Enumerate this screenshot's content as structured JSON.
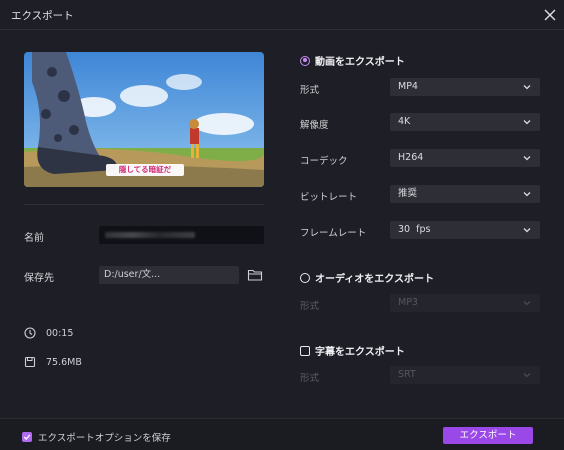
{
  "window": {
    "title": "エクスポート"
  },
  "left": {
    "name_label": "名前",
    "save_label": "保存先",
    "save_path": "D:/user/文...",
    "duration": "00:15",
    "size": "75.6MB",
    "subtitle_text": "隠してる暗証だ"
  },
  "video_section": {
    "label": "動画をエクスポート",
    "rows": [
      {
        "label": "形式",
        "value": "MP4"
      },
      {
        "label": "解像度",
        "value": "4K"
      },
      {
        "label": "コーデック",
        "value": "H264"
      },
      {
        "label": "ビットレート",
        "value": "推奨"
      },
      {
        "label": "フレームレート",
        "value": "30  fps"
      }
    ]
  },
  "audio_section": {
    "label": "オーディオをエクスポート",
    "format_label": "形式",
    "format_value": "MP3"
  },
  "subtitle_section": {
    "label": "字幕をエクスポート",
    "format_label": "形式",
    "format_value": "SRT"
  },
  "footer": {
    "keep_options_label": "エクスポートオプションを保存",
    "export_button": "エクスポート"
  },
  "colors": {
    "accent": "#9b48e8",
    "background": "#1e1f26"
  }
}
